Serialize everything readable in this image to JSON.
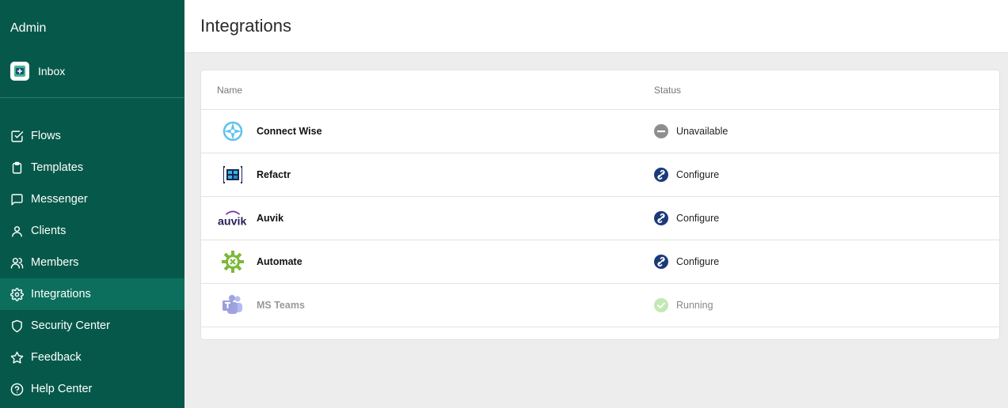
{
  "sidebar": {
    "title": "Admin",
    "inbox_label": "Inbox",
    "items": [
      {
        "label": "Flows",
        "icon": "check-square-icon",
        "active": false
      },
      {
        "label": "Templates",
        "icon": "clipboard-icon",
        "active": false
      },
      {
        "label": "Messenger",
        "icon": "chat-bubble-icon",
        "active": false
      },
      {
        "label": "Clients",
        "icon": "person-icon",
        "active": false
      },
      {
        "label": "Members",
        "icon": "people-icon",
        "active": false
      },
      {
        "label": "Integrations",
        "icon": "gear-icon",
        "active": true
      },
      {
        "label": "Security Center",
        "icon": "shield-icon",
        "active": false
      },
      {
        "label": "Feedback",
        "icon": "star-icon",
        "active": false
      },
      {
        "label": "Help Center",
        "icon": "question-circle-icon",
        "active": false
      }
    ],
    "bg_color": "#06594a",
    "active_color": "#0c6f5d"
  },
  "header": {
    "title": "Integrations"
  },
  "table": {
    "columns": [
      "Name",
      "Status"
    ],
    "rows": [
      {
        "name": "Connect Wise",
        "status": "Unavailable",
        "logo": "connectwise-logo",
        "status_icon": "minus-circle-icon"
      },
      {
        "name": "Refactr",
        "status": "Configure",
        "logo": "refactr-logo",
        "status_icon": "link-circle-icon"
      },
      {
        "name": "Auvik",
        "status": "Configure",
        "logo": "auvik-logo",
        "logo_text": "auvik",
        "status_icon": "link-circle-icon"
      },
      {
        "name": "Automate",
        "status": "Configure",
        "logo": "automate-logo",
        "status_icon": "link-circle-icon"
      },
      {
        "name": "MS Teams",
        "status": "Running",
        "logo": "ms-teams-logo",
        "status_icon": "check-circle-icon"
      }
    ]
  }
}
